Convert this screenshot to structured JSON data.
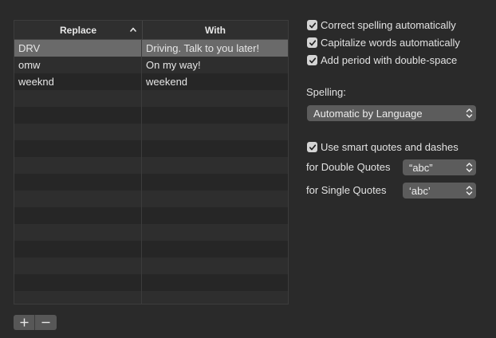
{
  "table": {
    "headers": {
      "replace": "Replace",
      "with": "With"
    },
    "rows": [
      {
        "replace": "DRV",
        "with": "Driving. Talk to you later!",
        "selected": true
      },
      {
        "replace": "omw",
        "with": "On my way!",
        "selected": false
      },
      {
        "replace": "weeknd",
        "with": "weekend",
        "selected": false
      }
    ]
  },
  "buttons": {
    "add": "+",
    "remove": "−"
  },
  "options": {
    "correct_spelling": "Correct spelling automatically",
    "capitalize_words": "Capitalize words automatically",
    "add_period": "Add period with double-space"
  },
  "spelling": {
    "label": "Spelling:",
    "value": "Automatic by Language"
  },
  "smart_quotes": {
    "checkbox_label": "Use smart quotes and dashes",
    "double_label": "for Double Quotes",
    "double_value": "“abc”",
    "single_label": "for Single Quotes",
    "single_value": "‘abc’"
  },
  "icons": {
    "sort": "chevron-up-icon",
    "popup": "updown-chevron-icon",
    "check": "checkmark-icon"
  }
}
